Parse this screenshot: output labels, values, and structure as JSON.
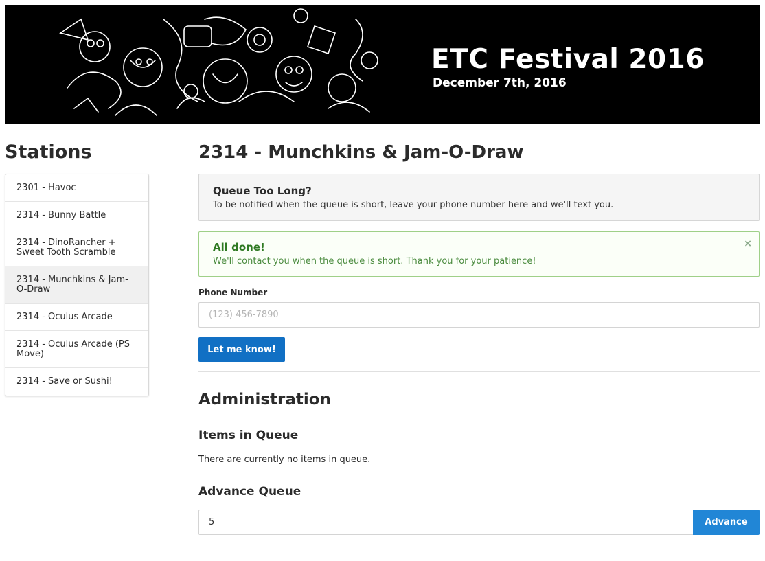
{
  "banner": {
    "title": "ETC Festival 2016",
    "date": "December 7th, 2016"
  },
  "sidebar": {
    "heading": "Stations",
    "items": [
      {
        "label": "2301 - Havoc"
      },
      {
        "label": "2314 - Bunny Battle"
      },
      {
        "label": "2314 - DinoRancher + Sweet Tooth Scramble"
      },
      {
        "label": "2314 - Munchkins & Jam-O-Draw",
        "active": true
      },
      {
        "label": "2314 - Oculus Arcade"
      },
      {
        "label": "2314 - Oculus Arcade (PS Move)"
      },
      {
        "label": "2314 - Save or Sushi!"
      }
    ]
  },
  "main": {
    "title": "2314 - Munchkins & Jam-O-Draw",
    "info_panel": {
      "title": "Queue Too Long?",
      "body": "To be notified when the queue is short, leave your phone number here and we'll text you."
    },
    "success_panel": {
      "title": "All done!",
      "body": "We'll contact you when the queue is short. Thank you for your patience!",
      "close": "×"
    },
    "phone_label": "Phone Number",
    "phone_placeholder": "(123) 456-7890",
    "phone_value": "",
    "submit_label": "Let me know!"
  },
  "admin": {
    "heading": "Administration",
    "items_heading": "Items in Queue",
    "items_empty": "There are currently no items in queue.",
    "advance_heading": "Advance Queue",
    "advance_value": "5",
    "advance_button": "Advance"
  },
  "colors": {
    "primary": "#1170c4",
    "advance": "#2186d6",
    "success_text": "#2f7a23",
    "success_border": "#9fd088"
  }
}
